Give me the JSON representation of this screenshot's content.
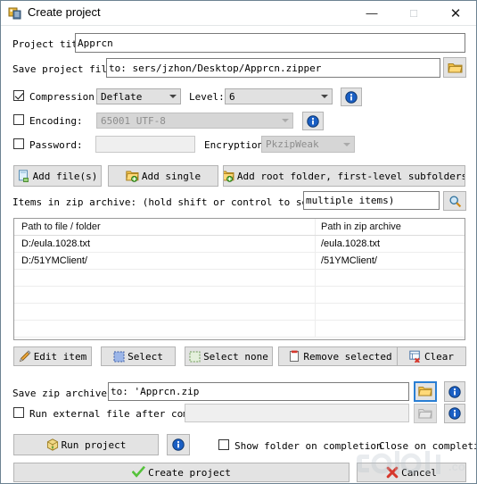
{
  "window": {
    "title": "Create project",
    "icon": "app-zip-icon",
    "controls": {
      "minimize": "—",
      "maximize": "□",
      "close": "✕"
    }
  },
  "project": {
    "title_label": "Project title:",
    "title_value": "Apprcn",
    "save_file_label": "Save project file to:",
    "save_file_value": "to: sers/jzhon/Desktop/Apprcn.zipper",
    "browse_icon": "folder-open-icon"
  },
  "options": {
    "compression": {
      "label": "Compression:",
      "checked": true,
      "value": "Deflate"
    },
    "level": {
      "label": "Level:",
      "value": "6"
    },
    "encoding": {
      "label": "Encoding:",
      "checked": false,
      "value": "65001 UTF-8"
    },
    "password": {
      "label": "Password:",
      "checked": false,
      "value": ""
    },
    "encryption": {
      "label": "Encryption:",
      "value": "PkzipWeak"
    },
    "info_icon": "info-icon"
  },
  "add_buttons": [
    {
      "label": "Add file(s)",
      "icon": "add-file-icon"
    },
    {
      "label": "Add single",
      "icon": "add-folder-icon"
    },
    {
      "label": "Add root folder, first-level subfolders",
      "icon": "add-root-folder-icon"
    }
  ],
  "items": {
    "label": "Items in zip archive: (hold shift or control to select",
    "filter_value": "multiple items)",
    "search_icon": "search-icon",
    "columns": [
      "Path to file / folder",
      "Path in zip archive"
    ],
    "rows": [
      {
        "path": "D:/eula.1028.txt",
        "zip_path": "/eula.1028.txt"
      },
      {
        "path": "D:/51YMClient/",
        "zip_path": "/51YMClient/"
      },
      {
        "path": "",
        "zip_path": ""
      },
      {
        "path": "",
        "zip_path": ""
      },
      {
        "path": "",
        "zip_path": ""
      },
      {
        "path": "",
        "zip_path": ""
      }
    ]
  },
  "item_buttons": [
    {
      "label": "Edit item",
      "icon": "pencil-icon"
    },
    {
      "label": "Select",
      "icon": "select-all-icon"
    },
    {
      "label": "Select none",
      "icon": "select-none-icon"
    },
    {
      "label": "Remove selected",
      "icon": "remove-icon"
    },
    {
      "label": "Clear",
      "icon": "clear-list-icon"
    }
  ],
  "output": {
    "zip_label": "Save zip archive to:",
    "zip_value": "to: 'Apprcn.zip",
    "zip_browse_icon": "folder-open-icon",
    "zip_info_icon": "info-icon",
    "run_external_label": "Run external file after completion:",
    "run_external_checked": false,
    "run_external_value": "",
    "run_browse_icon": "folder-icon",
    "run_info_icon": "info-icon"
  },
  "footer": {
    "run_project_label": "Run project",
    "run_project_icon": "package-icon",
    "run_info_icon": "info-icon",
    "show_folder_label": "Show folder on completion",
    "show_folder_checked": false,
    "close_on_completion_label": "Close on completion",
    "create_label": "Create project",
    "create_icon": "check-icon",
    "cancel_label": "Cancel",
    "cancel_icon": "red-x-icon"
  },
  "watermark": {
    "text": ".co"
  },
  "colors": {
    "accent": "#2a7fd4",
    "window_border": "#6d8392",
    "button_face": "#e3e3e3",
    "disabled_text": "#9b9b9b"
  }
}
